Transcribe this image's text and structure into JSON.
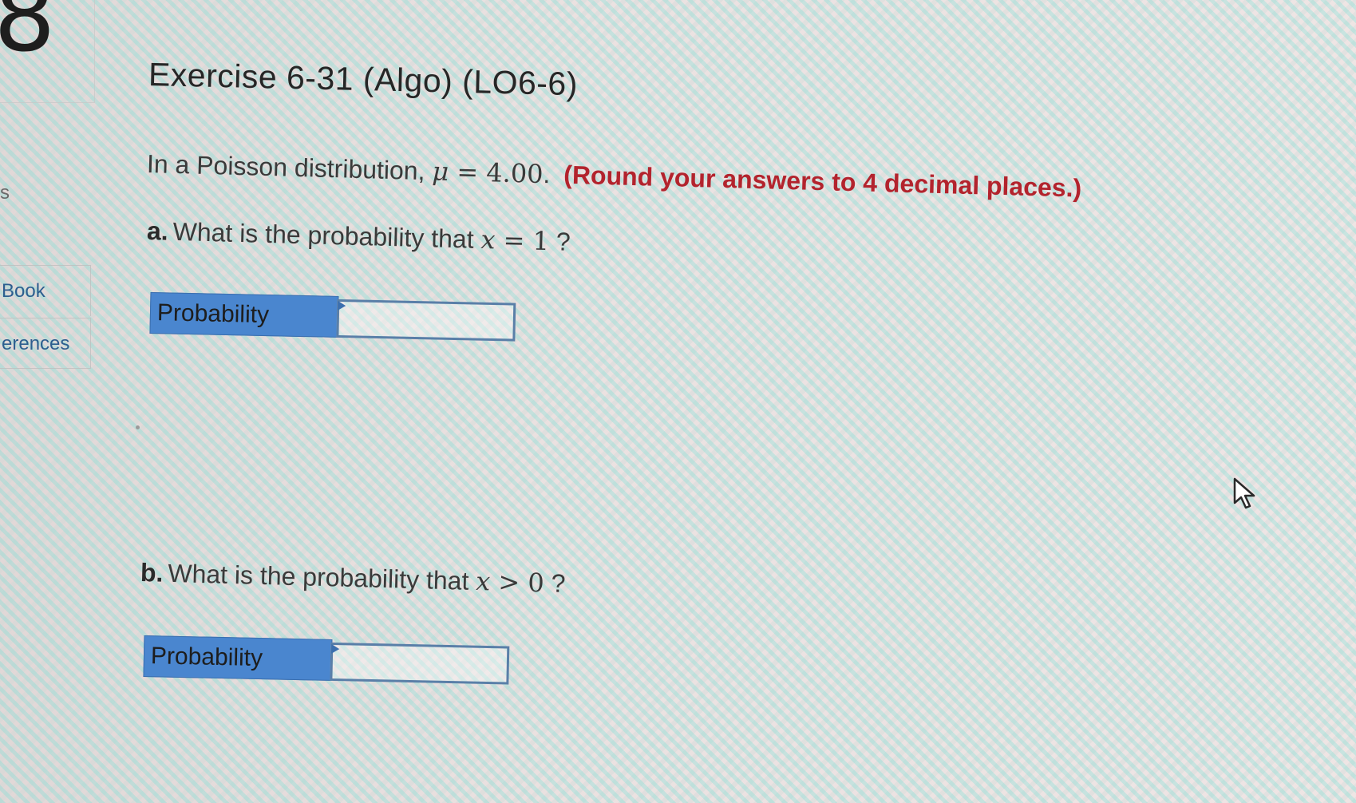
{
  "sidebar": {
    "question_number": "8",
    "partial_letter": "s",
    "links": [
      "Book",
      "erences"
    ]
  },
  "exercise": {
    "title": "Exercise 6-31 (Algo) (LO6-6)",
    "intro_text": "In a Poisson distribution, ",
    "mu_symbol": "μ",
    "equals": " = ",
    "mu_value": "4.00",
    "intro_end": ".",
    "note": "(Round your answers to 4 decimal places.)"
  },
  "questions": [
    {
      "letter": "a.",
      "text": "What is the probability that ",
      "var": "x",
      "operator": " = ",
      "value": "1",
      "end": " ?",
      "answer_label": "Probability",
      "answer_value": ""
    },
    {
      "letter": "b.",
      "text": "What is the probability that ",
      "var": "x",
      "operator": " > ",
      "value": "0",
      "end": " ?",
      "answer_label": "Probability",
      "answer_value": ""
    }
  ],
  "colors": {
    "label_bg": "#4a86cf",
    "note_red": "#b3232d",
    "link_blue": "#2d5e8f"
  },
  "icons": {
    "cursor": "mouse-pointer-icon"
  }
}
